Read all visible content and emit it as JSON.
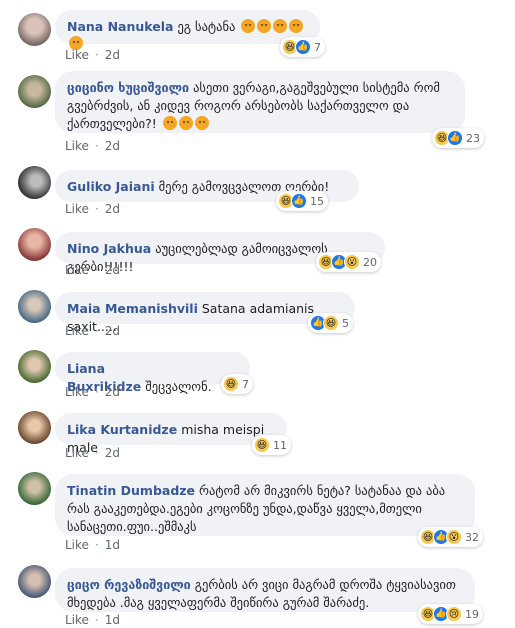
{
  "colors": {
    "author": "#385898",
    "bubble": "#f0f2f5",
    "meta": "#606770",
    "like_blue": "#1877f2",
    "haha_yellow": "#f7c84d"
  },
  "comments": [
    {
      "author": "Nana Nanukela",
      "text": "ეგ სატანა",
      "emojis": 5,
      "like": "Like",
      "time": "2d",
      "reactions": [
        "haha",
        "like"
      ],
      "count": "7"
    },
    {
      "author": "ციცინო ხუციშვილი",
      "text": "ასეთი ვერაგი,გაგეშვებული სისტემა რომ გვებრძვის, ან კიდევ როგორ არსებობს საქართველო და ქართველები?!",
      "emojis": 3,
      "like": "Like",
      "time": "2d",
      "reactions": [
        "haha",
        "like"
      ],
      "count": "23"
    },
    {
      "author": "Guliko Jaiani",
      "text": "მერე გამოვცვალოთ ღერბი!",
      "emojis": 0,
      "like": "Like",
      "time": "2d",
      "reactions": [
        "haha",
        "like"
      ],
      "count": "15"
    },
    {
      "author": "Nino Jakhua",
      "text": "აუცილებლად გამოიცვალოს გერბი!!!!!!",
      "emojis": 0,
      "like": "Like",
      "time": "2d",
      "reactions": [
        "haha",
        "like",
        "wow"
      ],
      "count": "20"
    },
    {
      "author": "Maia Memanishvili",
      "text": "Satana adamianis saxit.....",
      "emojis": 0,
      "like": "Like",
      "time": "2d",
      "reactions": [
        "like",
        "haha"
      ],
      "count": "5"
    },
    {
      "author": "Liana Buxrikidze",
      "text": "შეცვალონ.",
      "emojis": 0,
      "like": "Like",
      "time": "2d",
      "reactions": [
        "haha"
      ],
      "count": "7"
    },
    {
      "author": "Lika Kurtanidze",
      "text": "misha meispi male",
      "emojis": 0,
      "like": "Like",
      "time": "2d",
      "reactions": [
        "haha"
      ],
      "count": "11"
    },
    {
      "author": "Tinatin Dumbadze",
      "text": "რატომ არ მიკვირს ნეტა? სატანაა და აბა რას გააკეთებდა.ეგები კოცონზე უნდა,დაწვა ყველა,მთელი სანაცეთი.ფუი..ეშმაკს",
      "emojis": 0,
      "like": "Like",
      "time": "1d",
      "reactions": [
        "haha",
        "like",
        "wow"
      ],
      "count": "32"
    },
    {
      "author": "ციცო რევაზიშვილი",
      "text": "გერბის არ ვიცი მაგრამ დროშა ტყვიასავით მხედება .მაგ ყველაფერმა შეიწირა გურამ შარაძე.",
      "emojis": 0,
      "like": "Like",
      "time": "1d",
      "reactions": [
        "haha",
        "like",
        "sad"
      ],
      "count": "19"
    }
  ]
}
